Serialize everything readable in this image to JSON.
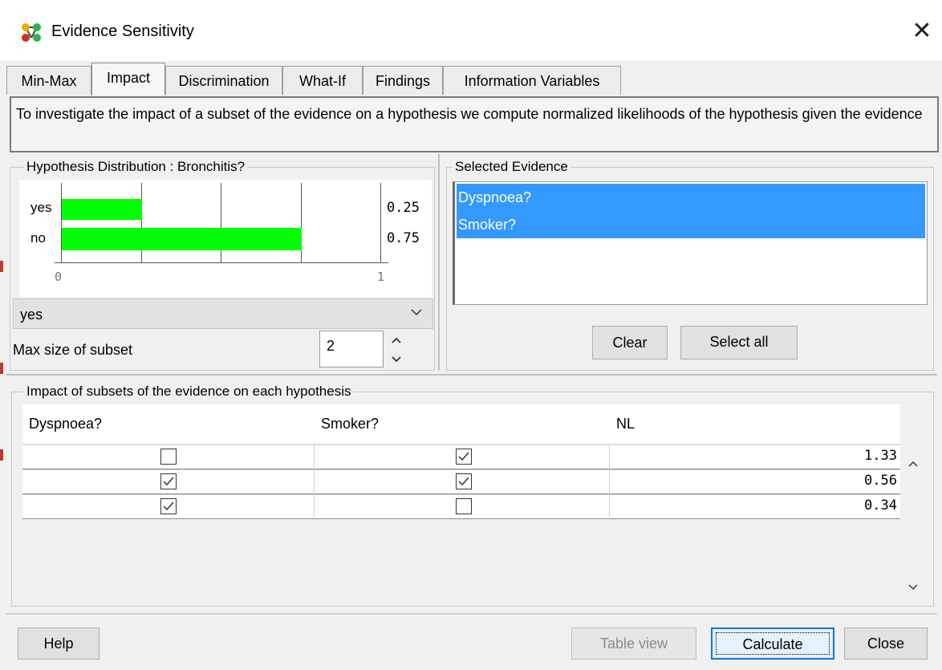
{
  "window": {
    "title": "Evidence Sensitivity"
  },
  "tabs": [
    "Min-Max",
    "Impact",
    "Discrimination",
    "What-If",
    "Findings",
    "Information Variables"
  ],
  "active_tab": "Impact",
  "description": "To investigate the impact of a subset of the evidence on a hypothesis we compute normalized likelihoods of the hypothesis given the evidence",
  "hypothesis": {
    "group_title": "Hypothesis Distribution : Bronchitis?",
    "states": [
      {
        "label": "yes",
        "value": 0.25,
        "value_text": "0.25"
      },
      {
        "label": "no",
        "value": 0.75,
        "value_text": "0.75"
      }
    ],
    "axis_min": "0",
    "axis_max": "1",
    "bar_color": "#00ff00",
    "selected_state": "yes"
  },
  "max_subset": {
    "label": "Max size of subset",
    "value": "2"
  },
  "selected_evidence": {
    "group_title": "Selected Evidence",
    "items": [
      "Dyspnoea?",
      "Smoker?"
    ],
    "highlight_color": "#3399ff",
    "clear_label": "Clear",
    "select_all_label": "Select all"
  },
  "impact": {
    "group_title": "Impact of subsets of the evidence on each hypothesis",
    "columns": [
      "Dyspnoea?",
      "Smoker?",
      "NL"
    ],
    "rows": [
      {
        "dyspnoea": false,
        "smoker": true,
        "nl": "1.33"
      },
      {
        "dyspnoea": true,
        "smoker": true,
        "nl": "0.56"
      },
      {
        "dyspnoea": true,
        "smoker": false,
        "nl": "0.34"
      }
    ]
  },
  "buttons": {
    "help": "Help",
    "table_view": "Table view",
    "calculate": "Calculate",
    "close": "Close"
  },
  "icons": [
    "network-app-icon",
    "close-icon",
    "chevron-down-icon",
    "spinner-up-icon",
    "spinner-down-icon",
    "scroll-up-icon",
    "scroll-down-icon",
    "checkmark-icon"
  ]
}
